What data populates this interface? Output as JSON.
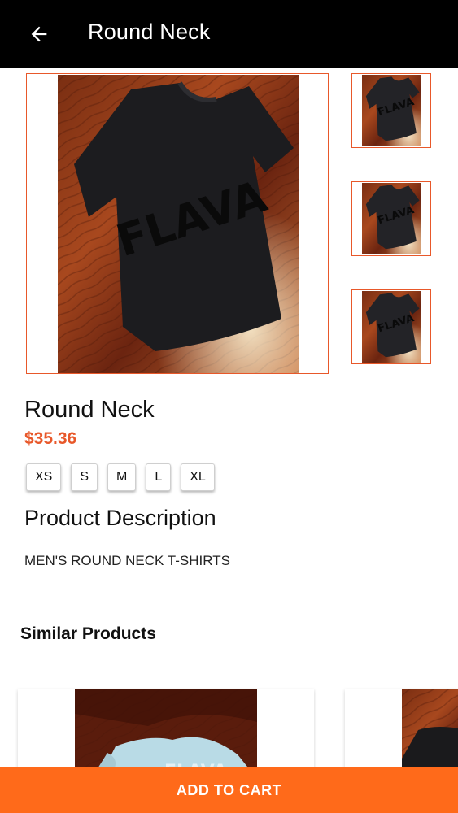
{
  "appbar": {
    "title": "Round Neck",
    "back_icon": "arrow-left-icon"
  },
  "gallery": {
    "main_image_alt": "black t-shirt",
    "thumbnails": [
      "black t-shirt",
      "black t-shirt",
      "black t-shirt"
    ],
    "shirt_print": "FLAVA"
  },
  "product": {
    "name": "Round Neck",
    "price": "$35.36",
    "sizes": [
      "XS",
      "S",
      "M",
      "L",
      "XL"
    ],
    "description_heading": "Product Description",
    "description": "MEN'S ROUND NECK T-SHIRTS"
  },
  "similar": {
    "heading": "Similar Products"
  },
  "cart": {
    "label": "ADD TO CART"
  },
  "colors": {
    "accent": "#e8582a",
    "cart_button": "#ff6a1a",
    "appbar": "#000000"
  }
}
